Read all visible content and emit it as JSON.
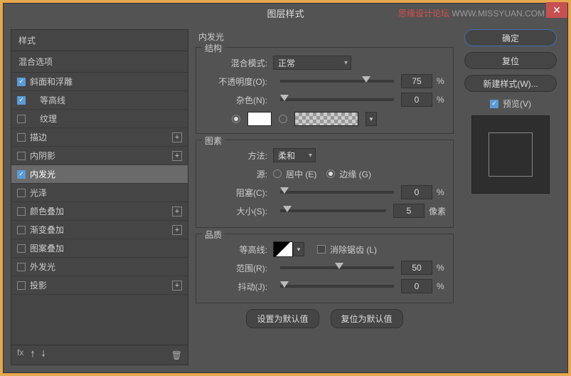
{
  "window": {
    "title": "图层样式",
    "brand_a": "思缘设计论坛",
    "brand_b": "WWW.MISSYUAN.COM",
    "close": "✕"
  },
  "left": {
    "styles": "样式",
    "blend": "混合选项",
    "rows": [
      {
        "label": "斜面和浮雕",
        "checked": true,
        "plus": false,
        "indent": 0,
        "sel": false
      },
      {
        "label": "等高线",
        "checked": true,
        "plus": false,
        "indent": 1,
        "sel": false
      },
      {
        "label": "纹理",
        "checked": false,
        "plus": false,
        "indent": 1,
        "sel": false
      },
      {
        "label": "描边",
        "checked": false,
        "plus": true,
        "indent": 0,
        "sel": false
      },
      {
        "label": "内阴影",
        "checked": false,
        "plus": true,
        "indent": 0,
        "sel": false
      },
      {
        "label": "内发光",
        "checked": true,
        "plus": false,
        "indent": 0,
        "sel": true
      },
      {
        "label": "光泽",
        "checked": false,
        "plus": false,
        "indent": 0,
        "sel": false
      },
      {
        "label": "颜色叠加",
        "checked": false,
        "plus": true,
        "indent": 0,
        "sel": false
      },
      {
        "label": "渐变叠加",
        "checked": false,
        "plus": true,
        "indent": 0,
        "sel": false
      },
      {
        "label": "图案叠加",
        "checked": false,
        "plus": false,
        "indent": 0,
        "sel": false
      },
      {
        "label": "外发光",
        "checked": false,
        "plus": false,
        "indent": 0,
        "sel": false
      },
      {
        "label": "投影",
        "checked": false,
        "plus": true,
        "indent": 0,
        "sel": false
      }
    ],
    "fx": "fx",
    "trash": "🗑"
  },
  "mid": {
    "header": "内发光",
    "g1": {
      "title": "结构",
      "blend_label": "混合模式:",
      "blend_value": "正常",
      "opacity_label": "不透明度(O):",
      "opacity": "75",
      "noise_label": "杂色(N):",
      "noise": "0",
      "pct": "%"
    },
    "g2": {
      "title": "图素",
      "tech_label": "方法:",
      "tech_value": "柔和",
      "source_label": "源:",
      "center": "居中 (E)",
      "edge": "边缘 (G)",
      "choke_label": "阻塞(C):",
      "choke": "0",
      "size_label": "大小(S):",
      "size": "5",
      "px": "像素",
      "pct": "%"
    },
    "g3": {
      "title": "品质",
      "contour_label": "等高线:",
      "aa_label": "消除锯齿 (L)",
      "range_label": "范围(R):",
      "range": "50",
      "jitter_label": "抖动(J):",
      "jitter": "0",
      "pct": "%"
    },
    "make_default": "设置为默认值",
    "reset_default": "复位为默认值"
  },
  "right": {
    "ok": "确定",
    "cancel": "复位",
    "new_style": "新建样式(W)...",
    "preview": "预览(V)"
  }
}
